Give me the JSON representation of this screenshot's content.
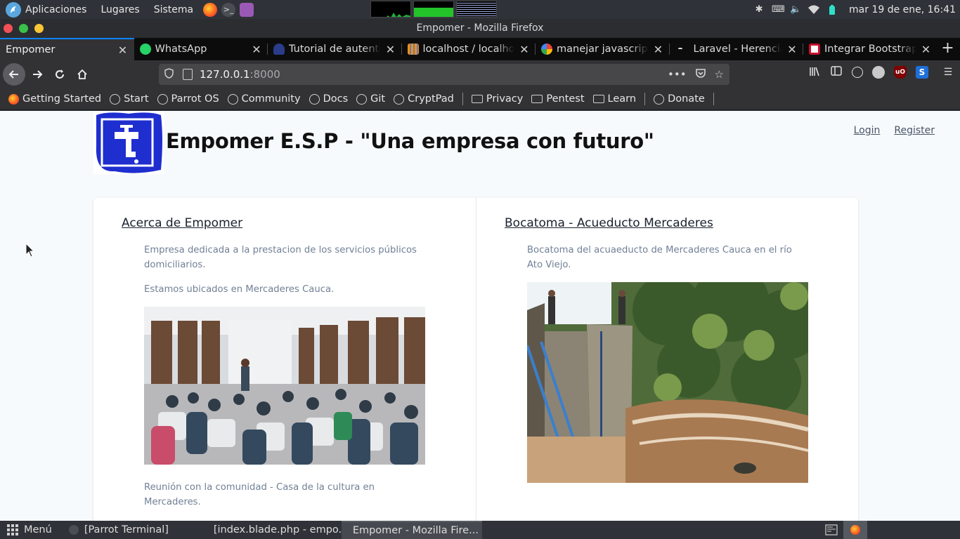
{
  "system_panel": {
    "menus": [
      "Aplicaciones",
      "Lugares",
      "Sistema"
    ],
    "clock": "mar 19 de ene, 16:41"
  },
  "window": {
    "title": "Empomer - Mozilla Firefox"
  },
  "tabs": [
    {
      "label": "Empomer",
      "favicon": "blank-icon",
      "active": true
    },
    {
      "label": "WhatsApp",
      "favicon": "whatsapp-icon",
      "active": false
    },
    {
      "label": "Tutorial de autentic",
      "favicon": "rocket-icon",
      "active": false
    },
    {
      "label": "localhost / localhost",
      "favicon": "phpmyadmin-icon",
      "active": false
    },
    {
      "label": "manejar javascript y",
      "favicon": "google-icon",
      "active": false
    },
    {
      "label": "Laravel - Herencia d",
      "favicon": "dash-icon",
      "active": false
    },
    {
      "label": "Integrar Bootstrap e",
      "favicon": "bootstrap-icon",
      "active": false
    }
  ],
  "urlbar": {
    "host": "127.0.0.1",
    "port": ":8000"
  },
  "bookmarks": [
    {
      "label": "Getting Started",
      "icon": "firefox-icon"
    },
    {
      "label": "Start",
      "icon": "globe-icon"
    },
    {
      "label": "Parrot OS",
      "icon": "globe-icon"
    },
    {
      "label": "Community",
      "icon": "globe-icon"
    },
    {
      "label": "Docs",
      "icon": "globe-icon"
    },
    {
      "label": "Git",
      "icon": "globe-icon"
    },
    {
      "label": "CryptPad",
      "icon": "globe-icon"
    },
    {
      "label": "Privacy",
      "icon": "folder-icon"
    },
    {
      "label": "Pentest",
      "icon": "folder-icon"
    },
    {
      "label": "Learn",
      "icon": "folder-icon"
    },
    {
      "label": "Donate",
      "icon": "globe-icon"
    }
  ],
  "page": {
    "title": "Empomer E.S.P - \"Una empresa con futuro\"",
    "login": "Login",
    "register": "Register",
    "left": {
      "heading": "Acerca de Empomer",
      "p1": "Empresa dedicada a la prestacion de los servicios públicos domiciliarios.",
      "p2": "Estamos ubicados en Mercaderes Cauca.",
      "caption": "Reunión con la comunidad - Casa de la cultura en Mercaderes."
    },
    "right": {
      "heading": "Bocatoma - Acueducto Mercaderes",
      "p1": "Bocatoma del acuaeducto de Mercaderes Cauca en el río Ato Viejo."
    }
  },
  "taskbar": {
    "menu": "Menú",
    "tasks": [
      {
        "label": "[Parrot Terminal]",
        "icon": "terminal-icon",
        "active": false
      },
      {
        "label": "[index.blade.php - empo...",
        "icon": "editor-icon",
        "active": false
      },
      {
        "label": "Empomer - Mozilla Fire...",
        "icon": "firefox-icon",
        "active": true
      }
    ]
  },
  "colors": {
    "accent": "#0a84ff",
    "page_bg": "#f7fafc",
    "link_text": "#4a5568",
    "muted_text": "#718096",
    "logo_blue": "#1f2ecf"
  }
}
